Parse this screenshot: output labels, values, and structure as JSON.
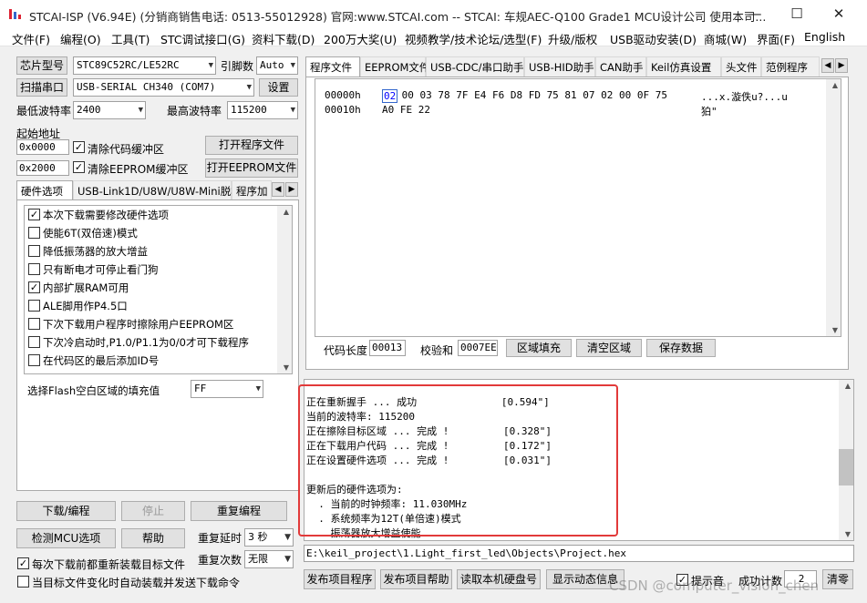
{
  "window": {
    "title": "STCAI-ISP (V6.94E) (分销商销售电话: 0513-55012928) 官网:www.STCAI.com  -- STCAI: 车规AEC-Q100 Grade1 MCU设计公司 使用本司..."
  },
  "menu": [
    "文件(F)",
    "编程(O)",
    "工具(T)",
    "STC调试接口(G)",
    "资料下载(D)",
    "200万大奖(U)",
    "视频教学/技术论坛/选型(F)",
    "升级/版权",
    "USB驱动安装(D)",
    "商城(W)",
    "界面(F)",
    "English"
  ],
  "left": {
    "chip_type_label": "芯片型号",
    "chip_type_value": "STC89C52RC/LE52RC",
    "pin_label": "引脚数",
    "pin_value": "Auto",
    "scan_button": "扫描串口",
    "port_value": "USB-SERIAL CH340 (COM7)",
    "settings_button": "设置",
    "min_baud_label": "最低波特率",
    "min_baud_value": "2400",
    "max_baud_label": "最高波特率",
    "max_baud_value": "115200",
    "start_addr_label": "起始地址",
    "addr1": "0x0000",
    "clear_code_label": "清除代码缓冲区",
    "open_program_button": "打开程序文件",
    "addr2": "0x2000",
    "clear_eeprom_label": "清除EEPROM缓冲区",
    "open_eeprom_button": "打开EEPROM文件",
    "tabs": [
      "硬件选项",
      "USB-Link1D/U8W/U8W-Mini脱机",
      "程序加"
    ],
    "options": [
      {
        "label": "本次下载需要修改硬件选项",
        "checked": true
      },
      {
        "label": "使能6T(双倍速)模式",
        "checked": false
      },
      {
        "label": "降低振荡器的放大增益",
        "checked": false
      },
      {
        "label": "只有断电才可停止看门狗",
        "checked": false
      },
      {
        "label": "内部扩展RAM可用",
        "checked": true
      },
      {
        "label": "ALE脚用作P4.5口",
        "checked": false
      },
      {
        "label": "下次下载用户程序时擦除用户EEPROM区",
        "checked": false
      },
      {
        "label": "下次冷启动时,P1.0/P1.1为0/0才可下载程序",
        "checked": false
      },
      {
        "label": "在代码区的最后添加ID号",
        "checked": false
      }
    ],
    "fill_label": "选择Flash空白区域的填充值",
    "fill_value": "FF",
    "download_button": "下载/编程",
    "stop_button": "停止",
    "redownload_button": "重复编程",
    "check_mcu_button": "检测MCU选项",
    "help_button": "帮助",
    "repeat_delay_label": "重复延时",
    "repeat_delay_value": "3 秒",
    "repeat_count_label": "重复次数",
    "repeat_count_value": "无限",
    "reload_label": "每次下载前都重新装载目标文件",
    "reload_checked": true,
    "auto_send_label": "当目标文件变化时自动装载并发送下载命令",
    "auto_send_checked": false
  },
  "right": {
    "tabs": [
      "程序文件",
      "EEPROM文件",
      "USB-CDC/串口助手",
      "USB-HID助手",
      "CAN助手",
      "Keil仿真设置",
      "头文件",
      "范例程序"
    ],
    "hex_lines": [
      {
        "addr": "00000h",
        "first": "02",
        "bytes": " 00 03 78 7F E4 F6 D8 FD 75 81 07 02 00 0F 75",
        "ascii": "...x.漩佚u?...u"
      },
      {
        "addr": "00010h",
        "first": "",
        "bytes": "A0 FE 22",
        "ascii": "狛\""
      }
    ],
    "code_len_label": "代码长度",
    "code_len_value": "00013",
    "checksum_label": "校验和",
    "checksum_value": "0007EE",
    "fill_area_button": "区域填充",
    "clear_area_button": "清空区域",
    "save_data_button": "保存数据",
    "log": [
      "正在重新握手 ... 成功              [0.594\"]",
      "当前的波特率: 115200",
      "正在擦除目标区域 ... 完成 !         [0.328\"]",
      "正在下载用户代码 ... 完成 !         [0.172\"]",
      "正在设置硬件选项 ... 完成 !         [0.031\"]",
      "",
      "更新后的硬件选项为:",
      "  . 当前的时钟频率: 11.030MHz",
      "  . 系统频率为12T(单倍速)模式",
      "  . 振荡器放大增益使能"
    ],
    "file_path": "E:\\keil_project\\1.Light_first_led\\Objects\\Project.hex",
    "publish_program_button": "发布项目程序",
    "publish_help_button": "发布项目帮助",
    "read_disk_button": "读取本机硬盘号",
    "show_dynamic_button": "显示动态信息",
    "beep_label": "提示音",
    "beep_checked": true,
    "success_count_label": "成功计数",
    "success_count_value": "2",
    "clear_button": "清零"
  },
  "watermark": "CSDN @computer_vision_chen",
  "colors": {
    "highlight_box": "#e23a3a",
    "selected_tab": "#ffffff"
  }
}
